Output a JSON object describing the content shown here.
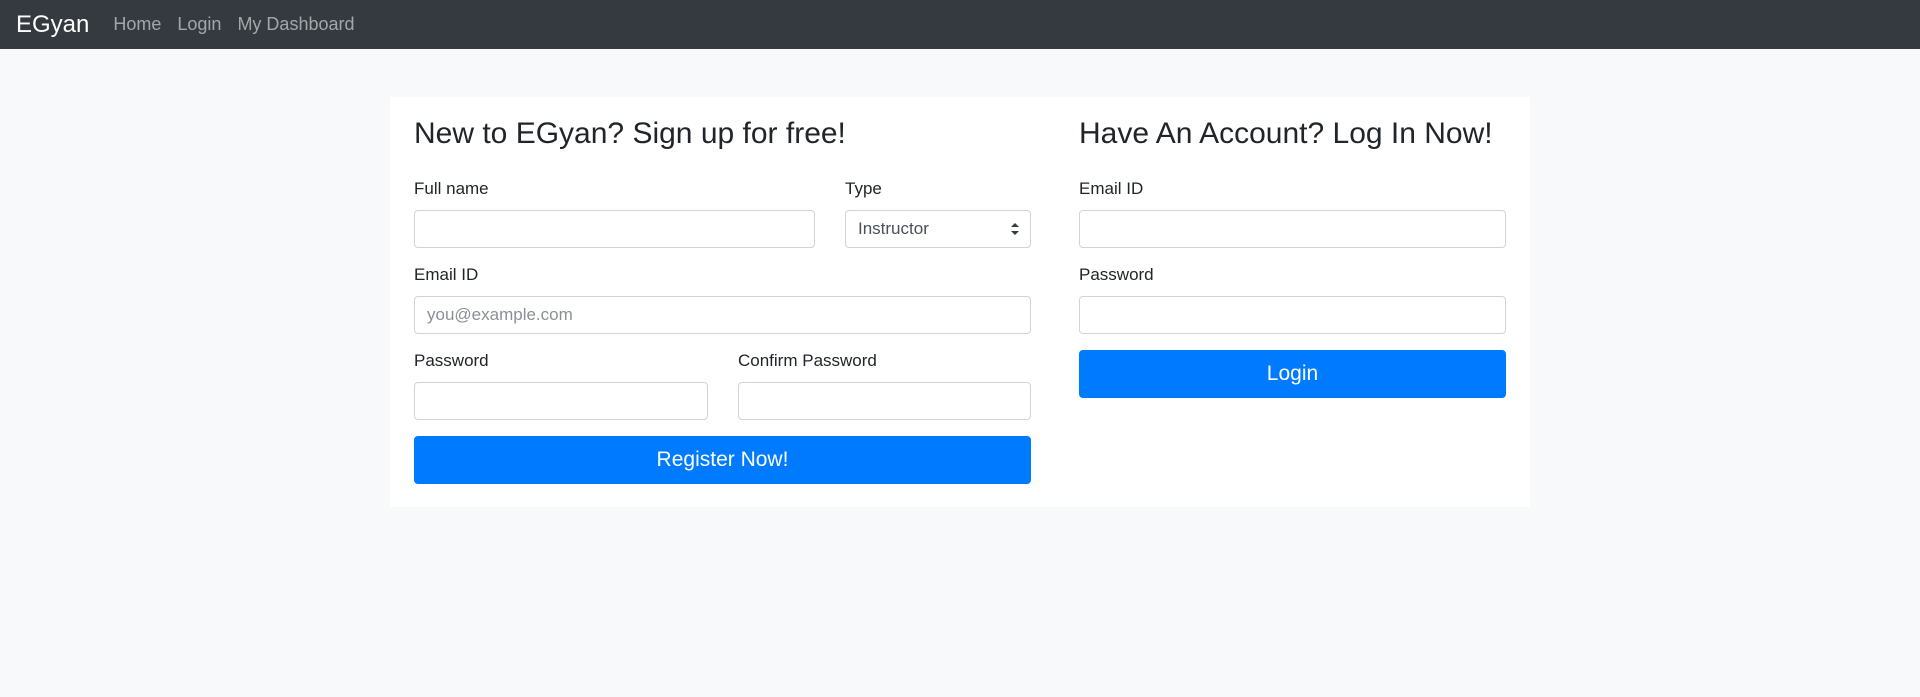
{
  "navbar": {
    "brand": "EGyan",
    "links": [
      "Home",
      "Login",
      "My Dashboard"
    ]
  },
  "signup": {
    "heading": "New to EGyan? Sign up for free!",
    "fullname_label": "Full name",
    "fullname_value": "",
    "type_label": "Type",
    "type_selected": "Instructor",
    "email_label": "Email ID",
    "email_placeholder": "you@example.com",
    "password_label": "Password",
    "confirm_password_label": "Confirm Password",
    "register_button": "Register Now!"
  },
  "login": {
    "heading": "Have An Account? Log In Now!",
    "email_label": "Email ID",
    "password_label": "Password",
    "login_button": "Login"
  },
  "colors": {
    "navbar_bg": "#343a40",
    "primary": "#007bff",
    "page_bg": "#f8f9fa",
    "card_bg": "#ffffff"
  }
}
